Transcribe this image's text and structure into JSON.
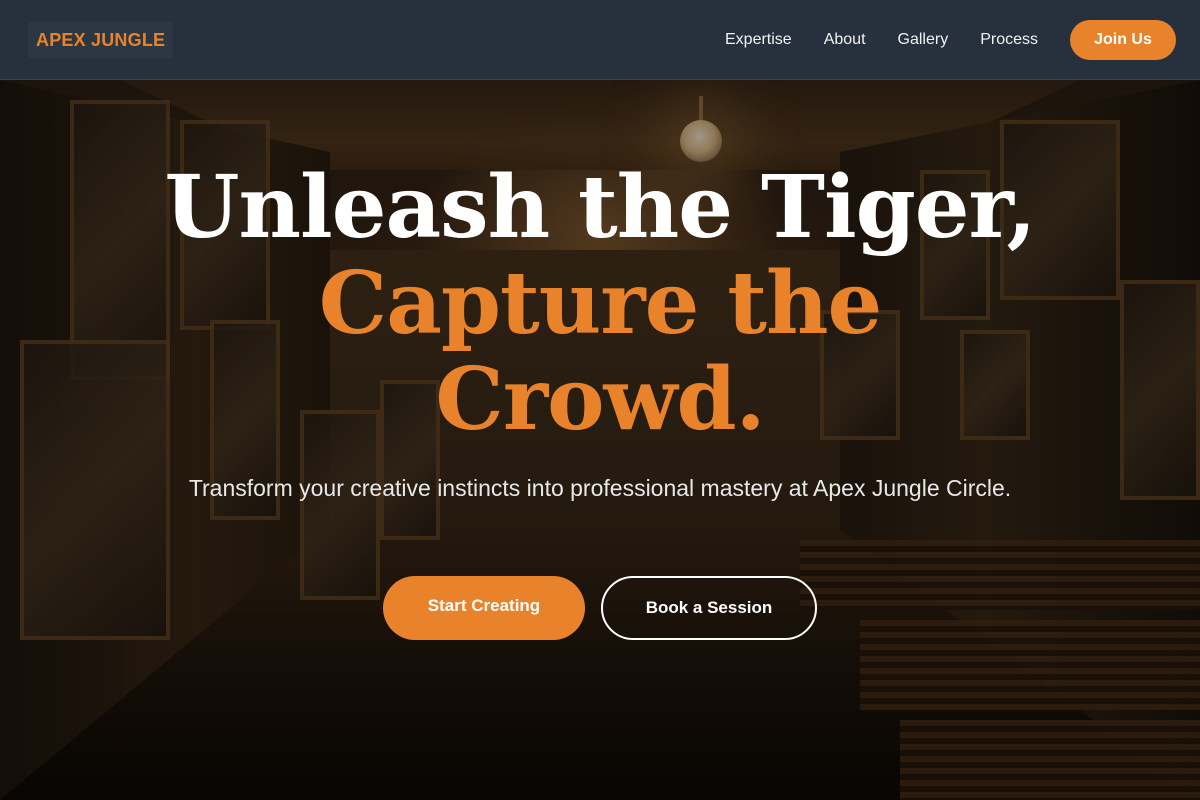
{
  "header": {
    "brand": "APEX JUNGLE",
    "nav": [
      {
        "label": "Expertise"
      },
      {
        "label": "About"
      },
      {
        "label": "Gallery"
      },
      {
        "label": "Process"
      }
    ],
    "cta_label": "Join Us"
  },
  "hero": {
    "title_line1": "Unleash the Tiger,",
    "title_line2": "Capture the",
    "title_line3": "Crowd.",
    "subtitle": "Transform your creative instincts into professional mastery at Apex Jungle Circle.",
    "primary_button": "Start Creating",
    "secondary_button": "Book a Session",
    "background": "art-studio-photo"
  },
  "colors": {
    "accent": "#e8832b",
    "header_bg": "#27313e",
    "text_light": "#ffffff"
  }
}
